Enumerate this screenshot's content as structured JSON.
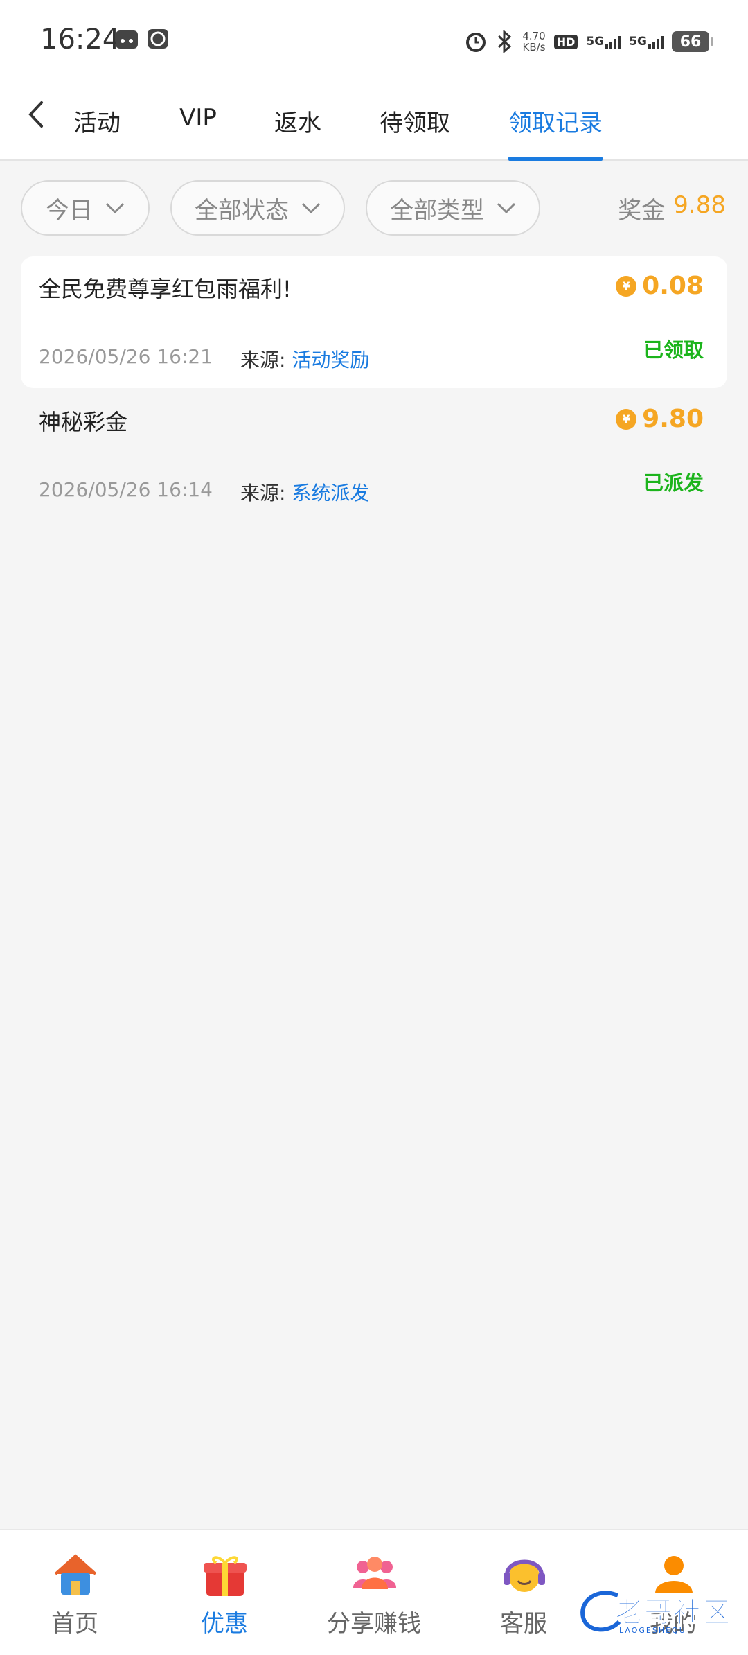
{
  "status_bar": {
    "time": "16:24",
    "speed_value": "4.70",
    "speed_unit": "KB/s",
    "hd_label": "HD",
    "net1": "5G",
    "net2": "5G",
    "battery": "66"
  },
  "tabs": [
    {
      "label": "活动",
      "active": false
    },
    {
      "label": "VIP",
      "active": false
    },
    {
      "label": "返水",
      "active": false
    },
    {
      "label": "待领取",
      "active": false
    },
    {
      "label": "领取记录",
      "active": true
    }
  ],
  "filters": {
    "date": "今日",
    "status": "全部状态",
    "type": "全部类型"
  },
  "bonus": {
    "label": "奖金",
    "value": "9.88"
  },
  "records": [
    {
      "title": "全民免费尊享红包雨福利!",
      "amount": "0.08",
      "time": "2026/05/26 16:21",
      "source_label": "来源:",
      "source_value": "活动奖励",
      "status": "已领取"
    },
    {
      "title": "神秘彩金",
      "amount": "9.80",
      "time": "2026/05/26 16:14",
      "source_label": "来源:",
      "source_value": "系统派发",
      "status": "已派发"
    }
  ],
  "coin_symbol": "¥",
  "bottom_nav": [
    {
      "label": "首页",
      "icon": "home-icon",
      "active": false
    },
    {
      "label": "优惠",
      "icon": "gift-icon",
      "active": true
    },
    {
      "label": "分享赚钱",
      "icon": "people-icon",
      "active": false
    },
    {
      "label": "客服",
      "icon": "headset-icon",
      "active": false
    },
    {
      "label": "我的",
      "icon": "user-icon",
      "active": false
    }
  ],
  "watermark": {
    "text": "老哥社区",
    "sub": "LAOGESHEQU"
  },
  "colors": {
    "accent": "#1a7be0",
    "gold": "#f5a623",
    "success": "#1cb41c"
  }
}
